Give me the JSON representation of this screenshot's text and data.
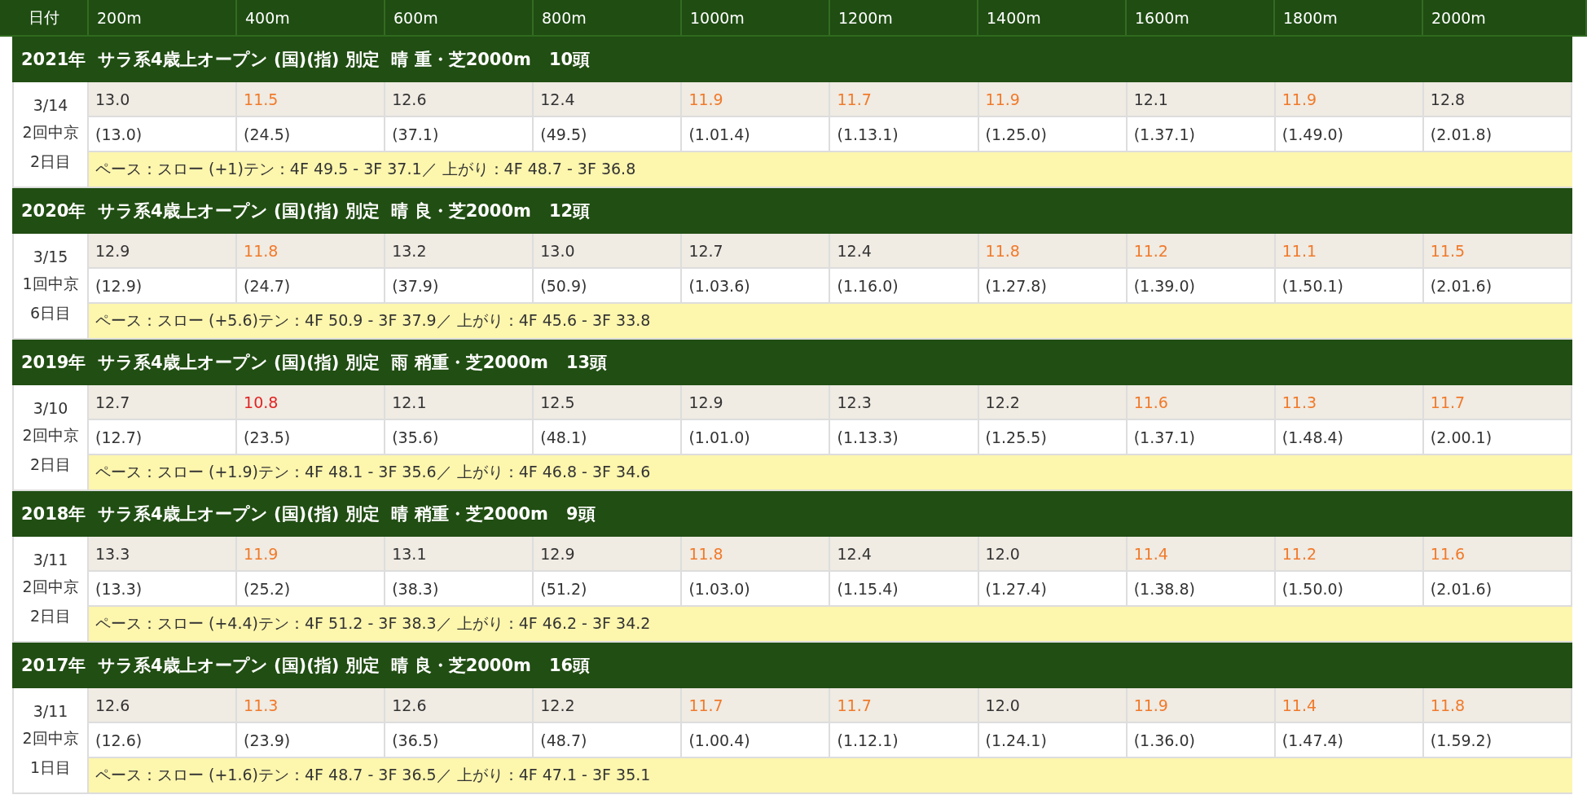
{
  "header": {
    "columns": [
      "日付",
      "200m",
      "400m",
      "600m",
      "800m",
      "1000m",
      "1200m",
      "1400m",
      "1600m",
      "1800m",
      "2000m"
    ]
  },
  "races": [
    {
      "title": "2021年  サラ系4歳上オープン (国)(指) 別定  晴 重・芝2000m   10頭",
      "date": "3/14",
      "meeting": "2回中京",
      "day": "2日目",
      "laps": [
        {
          "time": "13.0",
          "color": "#333333"
        },
        {
          "time": "11.5",
          "color": "#f07a2a"
        },
        {
          "time": "12.6",
          "color": "#333333"
        },
        {
          "time": "12.4",
          "color": "#333333"
        },
        {
          "time": "11.9",
          "color": "#f07a2a"
        },
        {
          "time": "11.7",
          "color": "#f07a2a"
        },
        {
          "time": "11.9",
          "color": "#f07a2a"
        },
        {
          "time": "12.1",
          "color": "#333333"
        },
        {
          "time": "11.9",
          "color": "#f07a2a"
        },
        {
          "time": "12.8",
          "color": "#333333"
        }
      ],
      "cumulative": [
        "(13.0)",
        "(24.5)",
        "(37.1)",
        "(49.5)",
        "(1.01.4)",
        "(1.13.1)",
        "(1.25.0)",
        "(1.37.1)",
        "(1.49.0)",
        "(2.01.8)"
      ],
      "pace": "ペース：スロー (+1)テン：4F 49.5 - 3F 37.1／ 上がり：4F 48.7 - 3F 36.8"
    },
    {
      "title": "2020年  サラ系4歳上オープン (国)(指) 別定  晴 良・芝2000m   12頭",
      "date": "3/15",
      "meeting": "1回中京",
      "day": "6日目",
      "laps": [
        {
          "time": "12.9",
          "color": "#333333"
        },
        {
          "time": "11.8",
          "color": "#f07a2a"
        },
        {
          "time": "13.2",
          "color": "#333333"
        },
        {
          "time": "13.0",
          "color": "#333333"
        },
        {
          "time": "12.7",
          "color": "#333333"
        },
        {
          "time": "12.4",
          "color": "#333333"
        },
        {
          "time": "11.8",
          "color": "#f07a2a"
        },
        {
          "time": "11.2",
          "color": "#f07a2a"
        },
        {
          "time": "11.1",
          "color": "#f07a2a"
        },
        {
          "time": "11.5",
          "color": "#f07a2a"
        }
      ],
      "cumulative": [
        "(12.9)",
        "(24.7)",
        "(37.9)",
        "(50.9)",
        "(1.03.6)",
        "(1.16.0)",
        "(1.27.8)",
        "(1.39.0)",
        "(1.50.1)",
        "(2.01.6)"
      ],
      "pace": "ペース：スロー (+5.6)テン：4F 50.9 - 3F 37.9／ 上がり：4F 45.6 - 3F 33.8"
    },
    {
      "title": "2019年  サラ系4歳上オープン (国)(指) 別定  雨 稍重・芝2000m   13頭",
      "date": "3/10",
      "meeting": "2回中京",
      "day": "2日目",
      "laps": [
        {
          "time": "12.7",
          "color": "#333333"
        },
        {
          "time": "10.8",
          "color": "#e02424"
        },
        {
          "time": "12.1",
          "color": "#333333"
        },
        {
          "time": "12.5",
          "color": "#333333"
        },
        {
          "time": "12.9",
          "color": "#333333"
        },
        {
          "time": "12.3",
          "color": "#333333"
        },
        {
          "time": "12.2",
          "color": "#333333"
        },
        {
          "time": "11.6",
          "color": "#f07a2a"
        },
        {
          "time": "11.3",
          "color": "#f07a2a"
        },
        {
          "time": "11.7",
          "color": "#f07a2a"
        }
      ],
      "cumulative": [
        "(12.7)",
        "(23.5)",
        "(35.6)",
        "(48.1)",
        "(1.01.0)",
        "(1.13.3)",
        "(1.25.5)",
        "(1.37.1)",
        "(1.48.4)",
        "(2.00.1)"
      ],
      "pace": "ペース：スロー (+1.9)テン：4F 48.1 - 3F 35.6／ 上がり：4F 46.8 - 3F 34.6"
    },
    {
      "title": "2018年  サラ系4歳上オープン (国)(指) 別定  晴 稍重・芝2000m   9頭",
      "date": "3/11",
      "meeting": "2回中京",
      "day": "2日目",
      "laps": [
        {
          "time": "13.3",
          "color": "#333333"
        },
        {
          "time": "11.9",
          "color": "#f07a2a"
        },
        {
          "time": "13.1",
          "color": "#333333"
        },
        {
          "time": "12.9",
          "color": "#333333"
        },
        {
          "time": "11.8",
          "color": "#f07a2a"
        },
        {
          "time": "12.4",
          "color": "#333333"
        },
        {
          "time": "12.0",
          "color": "#333333"
        },
        {
          "time": "11.4",
          "color": "#f07a2a"
        },
        {
          "time": "11.2",
          "color": "#f07a2a"
        },
        {
          "time": "11.6",
          "color": "#f07a2a"
        }
      ],
      "cumulative": [
        "(13.3)",
        "(25.2)",
        "(38.3)",
        "(51.2)",
        "(1.03.0)",
        "(1.15.4)",
        "(1.27.4)",
        "(1.38.8)",
        "(1.50.0)",
        "(2.01.6)"
      ],
      "pace": "ペース：スロー (+4.4)テン：4F 51.2 - 3F 38.3／ 上がり：4F 46.2 - 3F 34.2"
    },
    {
      "title": "2017年  サラ系4歳上オープン (国)(指) 別定  晴 良・芝2000m   16頭",
      "date": "3/11",
      "meeting": "2回中京",
      "day": "1日目",
      "laps": [
        {
          "time": "12.6",
          "color": "#333333"
        },
        {
          "time": "11.3",
          "color": "#f07a2a"
        },
        {
          "time": "12.6",
          "color": "#333333"
        },
        {
          "time": "12.2",
          "color": "#333333"
        },
        {
          "time": "11.7",
          "color": "#f07a2a"
        },
        {
          "time": "11.7",
          "color": "#f07a2a"
        },
        {
          "time": "12.0",
          "color": "#333333"
        },
        {
          "time": "11.9",
          "color": "#f07a2a"
        },
        {
          "time": "11.4",
          "color": "#f07a2a"
        },
        {
          "time": "11.8",
          "color": "#f07a2a"
        }
      ],
      "cumulative": [
        "(12.6)",
        "(23.9)",
        "(36.5)",
        "(48.7)",
        "(1.00.4)",
        "(1.12.1)",
        "(1.24.1)",
        "(1.36.0)",
        "(1.47.4)",
        "(1.59.2)"
      ],
      "pace": "ペース：スロー (+1.6)テン：4F 48.7 - 3F 36.5／ 上がり：4F 47.1 - 3F 35.1"
    }
  ]
}
